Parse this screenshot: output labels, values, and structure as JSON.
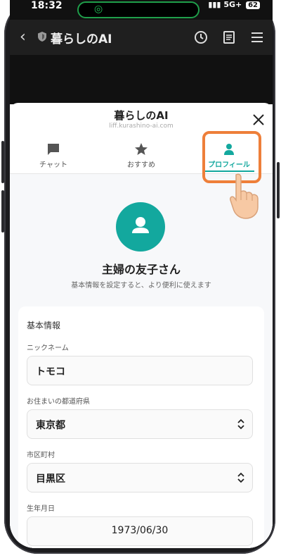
{
  "status_bar": {
    "time": "18:32",
    "network": "5G+",
    "battery": "62"
  },
  "browser": {
    "title": "暮らしのAI"
  },
  "sheet": {
    "title": "暮らしのAI",
    "url": "liff.kurashino-ai.com",
    "tabs": [
      {
        "label": "チャット",
        "icon": "chat-icon",
        "active": false
      },
      {
        "label": "おすすめ",
        "icon": "star-icon",
        "active": false
      },
      {
        "label": "プロフィール",
        "icon": "person-icon",
        "active": true
      }
    ]
  },
  "profile": {
    "name": "主婦の友子さん",
    "description": "基本情報を設定すると、より便利に使えます"
  },
  "form": {
    "section_title": "基本情報",
    "nickname_label": "ニックネーム",
    "nickname_value": "トモコ",
    "prefecture_label": "お住まいの都道府県",
    "prefecture_value": "東京都",
    "city_label": "市区町村",
    "city_value": "目黒区",
    "birthdate_label": "生年月日",
    "birthdate_value": "1973/06/30"
  },
  "colors": {
    "accent": "#13a89e",
    "highlight": "#ee7f3a",
    "dark_bg": "#1f1f1f"
  }
}
